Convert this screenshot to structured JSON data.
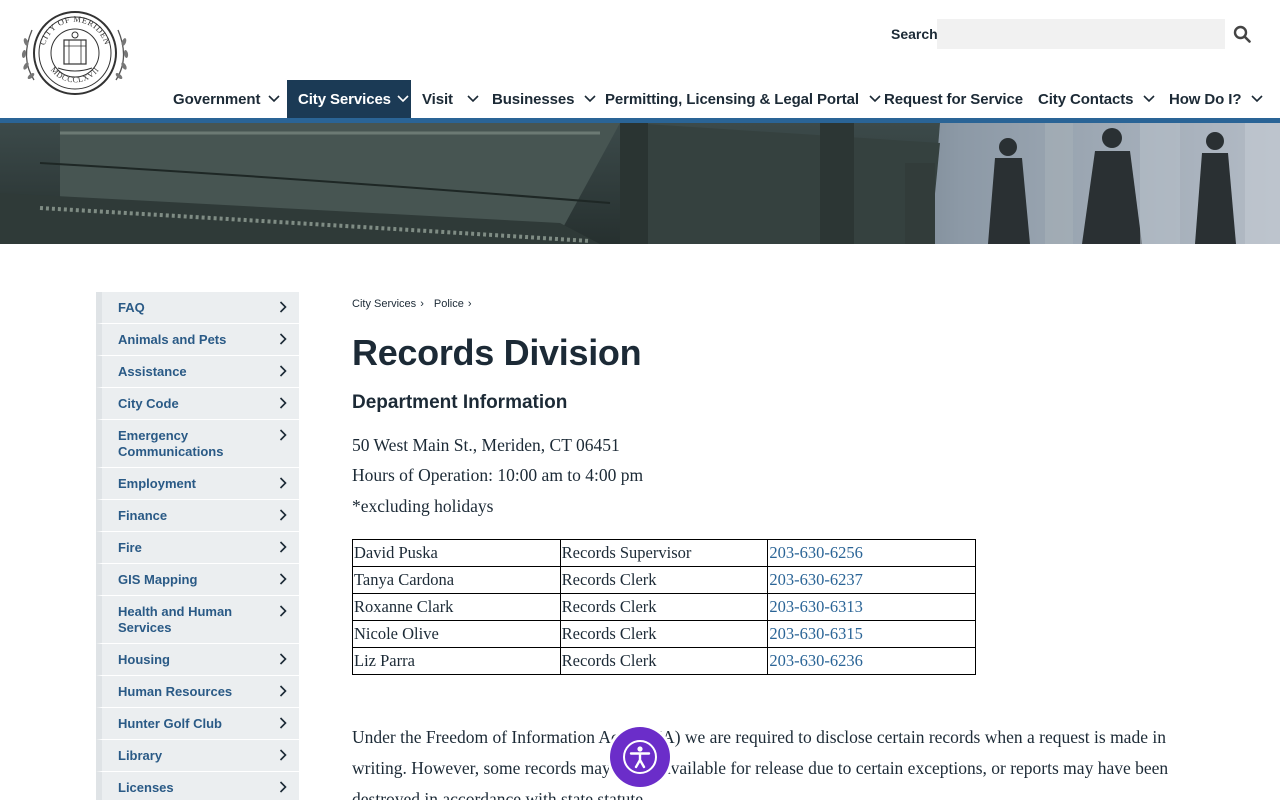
{
  "header": {
    "logo_text_top": "CITY OF MERIDEN",
    "logo_text_bottom": "MDCCCLXVII",
    "search_label": "Search",
    "search_placeholder": "",
    "search_value": ""
  },
  "nav": {
    "items": [
      {
        "label": "Government",
        "has_dropdown": true,
        "active": false
      },
      {
        "label": "City Services",
        "has_dropdown": true,
        "active": true
      },
      {
        "label": "Visit",
        "has_dropdown": true,
        "active": false
      },
      {
        "label": "Businesses",
        "has_dropdown": true,
        "active": false
      },
      {
        "label": "Permitting, Licensing & Legal Portal",
        "has_dropdown": true,
        "active": false
      },
      {
        "label": "Request for Service",
        "has_dropdown": false,
        "active": false
      },
      {
        "label": "City Contacts",
        "has_dropdown": true,
        "active": false
      },
      {
        "label": "How Do I?",
        "has_dropdown": true,
        "active": false
      }
    ]
  },
  "sidebar": {
    "items": [
      {
        "label": "FAQ"
      },
      {
        "label": "Animals and Pets"
      },
      {
        "label": "Assistance"
      },
      {
        "label": "City Code"
      },
      {
        "label": "Emergency Communications"
      },
      {
        "label": "Employment"
      },
      {
        "label": "Finance"
      },
      {
        "label": "Fire"
      },
      {
        "label": "GIS Mapping"
      },
      {
        "label": "Health and Human Services"
      },
      {
        "label": "Housing"
      },
      {
        "label": "Human Resources"
      },
      {
        "label": "Hunter Golf Club"
      },
      {
        "label": "Library"
      },
      {
        "label": "Licenses"
      }
    ]
  },
  "breadcrumb": [
    {
      "label": "City Services"
    },
    {
      "label": "Police"
    }
  ],
  "breadcrumb_separator": "›",
  "main": {
    "title": "Records Division",
    "section_heading": "Department Information",
    "address": "50 West Main St., Meriden, CT 06451",
    "hours": "Hours of Operation: 10:00 am to 4:00 pm",
    "hours_note": "*excluding holidays",
    "contacts": [
      {
        "name": "David Puska",
        "role": "Records Supervisor",
        "phone": "203-630-6256"
      },
      {
        "name": "Tanya Cardona",
        "role": "Records Clerk",
        "phone": "203-630-6237"
      },
      {
        "name": "Roxanne Clark",
        "role": "Records Clerk",
        "phone": "203-630-6313"
      },
      {
        "name": "Nicole Olive",
        "role": "Records Clerk",
        "phone": "203-630-6315"
      },
      {
        "name": "Liz Parra",
        "role": "Records Clerk",
        "phone": "203-630-6236"
      }
    ],
    "foia_text": "Under the Freedom of Information Act (FOIA) we are required to disclose certain records when a request is made in writing. However, some records may not be available for release due to certain exceptions, or reports may have been destroyed in accordance with state statute."
  },
  "colors": {
    "nav_active_bg": "#1b3a55",
    "accent_bar": "#2a6496",
    "sidebar_link": "#2a5a86",
    "phone_link": "#2a6496",
    "accessibility_button": "#6b2dc9"
  },
  "icons": {
    "search": "search-icon",
    "dropdown": "chevron-down-icon",
    "sidebar_arrow": "chevron-right-icon",
    "accessibility": "accessibility-icon"
  }
}
